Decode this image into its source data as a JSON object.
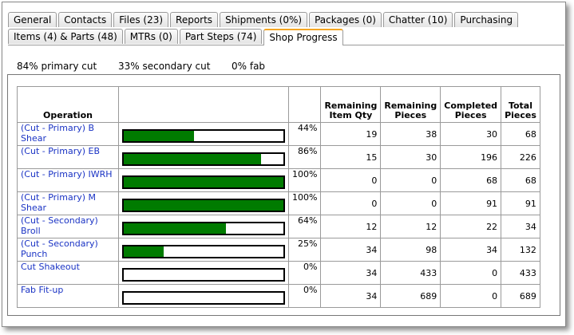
{
  "tabs_row1": [
    {
      "label": "General"
    },
    {
      "label": "Contacts"
    },
    {
      "label": "Files (23)"
    },
    {
      "label": "Reports"
    },
    {
      "label": "Shipments (0%)"
    },
    {
      "label": "Packages (0)"
    },
    {
      "label": "Chatter (10)"
    },
    {
      "label": "Purchasing"
    }
  ],
  "tabs_row2": [
    {
      "label": "Items (4) & Parts (48)"
    },
    {
      "label": "MTRs (0)"
    },
    {
      "label": "Part Steps (74)"
    },
    {
      "label": "Shop Progress"
    }
  ],
  "active_tab": "Shop Progress",
  "summary": {
    "primary": "84% primary cut",
    "secondary": "33% secondary cut",
    "fab": "0% fab"
  },
  "table": {
    "headers": {
      "operation": "Operation",
      "remaining_qty": "Remaining Item Qty",
      "remaining_pieces": "Remaining Pieces",
      "completed_pieces": "Completed Pieces",
      "total_pieces": "Total Pieces"
    },
    "rows": [
      {
        "operation": "(Cut - Primary) B Shear",
        "progress": 44,
        "percent": "44%",
        "remaining_qty": "19",
        "remaining_pieces": "38",
        "completed_pieces": "30",
        "total_pieces": "68"
      },
      {
        "operation": "(Cut - Primary) EB",
        "progress": 86,
        "percent": "86%",
        "remaining_qty": "15",
        "remaining_pieces": "30",
        "completed_pieces": "196",
        "total_pieces": "226"
      },
      {
        "operation": "(Cut - Primary) IWRH",
        "progress": 100,
        "percent": "100%",
        "remaining_qty": "0",
        "remaining_pieces": "0",
        "completed_pieces": "68",
        "total_pieces": "68"
      },
      {
        "operation": "(Cut - Primary) M Shear",
        "progress": 100,
        "percent": "100%",
        "remaining_qty": "0",
        "remaining_pieces": "0",
        "completed_pieces": "91",
        "total_pieces": "91"
      },
      {
        "operation": "(Cut - Secondary) Broll",
        "progress": 64,
        "percent": "64%",
        "remaining_qty": "12",
        "remaining_pieces": "12",
        "completed_pieces": "22",
        "total_pieces": "34"
      },
      {
        "operation": "(Cut - Secondary) Punch",
        "progress": 25,
        "percent": "25%",
        "remaining_qty": "34",
        "remaining_pieces": "98",
        "completed_pieces": "34",
        "total_pieces": "132"
      },
      {
        "operation": "Cut Shakeout",
        "progress": 0,
        "percent": "0%",
        "remaining_qty": "34",
        "remaining_pieces": "433",
        "completed_pieces": "0",
        "total_pieces": "433"
      },
      {
        "operation": "Fab Fit-up",
        "progress": 0,
        "percent": "0%",
        "remaining_qty": "34",
        "remaining_pieces": "689",
        "completed_pieces": "0",
        "total_pieces": "689"
      }
    ]
  },
  "colors": {
    "progress_fill": "#007b00",
    "link": "#1a33c4",
    "active_tab_accent": "#f5a623"
  }
}
